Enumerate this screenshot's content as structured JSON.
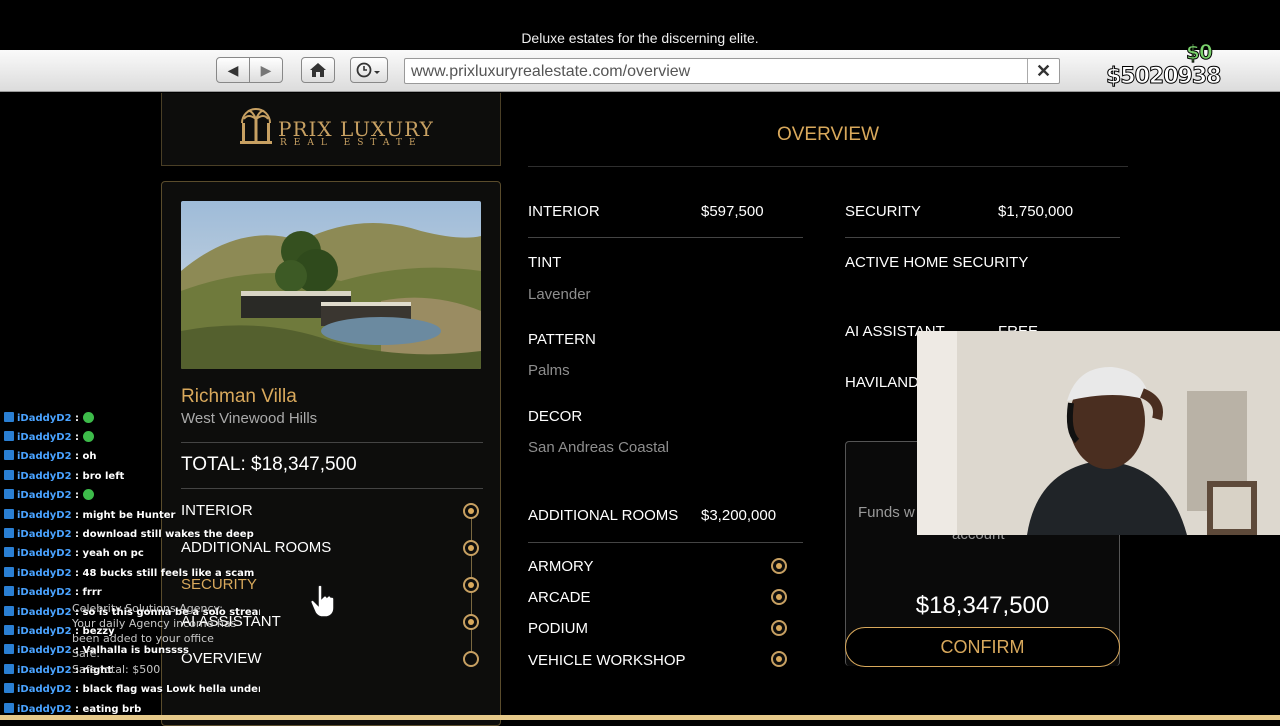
{
  "tagline": "Deluxe estates for the discerning elite.",
  "browser": {
    "url": "www.prixluxuryrealestate.com/overview"
  },
  "hud": {
    "bank_cash": "$0",
    "cash": "$5020938"
  },
  "logo": {
    "name": "PRIX LUXURY",
    "subtitle": "REAL ESTATE"
  },
  "property": {
    "name": "Richman Villa",
    "location": "West Vinewood Hills",
    "total": "TOTAL:  $18,347,500",
    "steps": [
      {
        "label": "INTERIOR",
        "checked": true
      },
      {
        "label": "ADDITIONAL ROOMS",
        "checked": true
      },
      {
        "label": "SECURITY",
        "checked": true
      },
      {
        "label": "AI ASSISTANT",
        "checked": true
      },
      {
        "label": "OVERVIEW",
        "checked": false
      }
    ]
  },
  "overview": {
    "title": "OVERVIEW",
    "interior": {
      "label": "INTERIOR",
      "price": "$597,500",
      "tint_label": "TINT",
      "tint_value": "Lavender",
      "pattern_label": "PATTERN",
      "pattern_value": "Palms",
      "decor_label": "DECOR",
      "decor_value": "San Andreas Coastal"
    },
    "additional_rooms": {
      "label": "ADDITIONAL ROOMS",
      "price": "$3,200,000",
      "items": [
        "ARMORY",
        "ARCADE",
        "PODIUM",
        "VEHICLE WORKSHOP"
      ]
    },
    "security": {
      "label": "SECURITY",
      "price": "$1,750,000",
      "item": "ACTIVE HOME SECURITY"
    },
    "ai_assistant": {
      "label": "AI ASSISTANT",
      "price": "FREE",
      "item": "HAVILAND"
    }
  },
  "confirm": {
    "funds_text_1": "Funds w",
    "funds_text_2": "account",
    "price": "$18,347,500",
    "button": "CONFIRM"
  },
  "chat": [
    {
      "user": "iDaddyD2",
      "msg": "",
      "emote": true
    },
    {
      "user": "iDaddyD2",
      "msg": "",
      "emote": true
    },
    {
      "user": "iDaddyD2",
      "msg": "oh",
      "emote": false
    },
    {
      "user": "iDaddyD2",
      "msg": "bro left",
      "emote": false
    },
    {
      "user": "iDaddyD2",
      "msg": "",
      "emote": true
    },
    {
      "user": "iDaddyD2",
      "msg": "might be Hunter",
      "emote": false
    },
    {
      "user": "iDaddyD2",
      "msg": "download still wakes the deep",
      "emote": false
    },
    {
      "user": "iDaddyD2",
      "msg": "yeah on pc",
      "emote": false
    },
    {
      "user": "iDaddyD2",
      "msg": "48 bucks still feels like a scam",
      "emote": false
    },
    {
      "user": "iDaddyD2",
      "msg": "frrr",
      "emote": false
    },
    {
      "user": "iDaddyD2",
      "msg": "so is this gonna be a solo stream?",
      "emote": false
    },
    {
      "user": "iDaddyD2",
      "msg": "bezzy",
      "emote": false
    },
    {
      "user": "iDaddyD2",
      "msg": "Valhalla is bunssss",
      "emote": false
    },
    {
      "user": "iDaddyD2",
      "msg": "night",
      "emote": false
    },
    {
      "user": "iDaddyD2",
      "msg": "black flag was Lowk hella underrated",
      "emote": false
    },
    {
      "user": "iDaddyD2",
      "msg": "eating brb",
      "emote": false
    }
  ],
  "notification": {
    "line1": "Celebrity Solutions Agency:",
    "line2": "Your daily Agency income has",
    "line3": "been added to your office",
    "line4": "Safe.",
    "line5": "Safe total: $500"
  }
}
